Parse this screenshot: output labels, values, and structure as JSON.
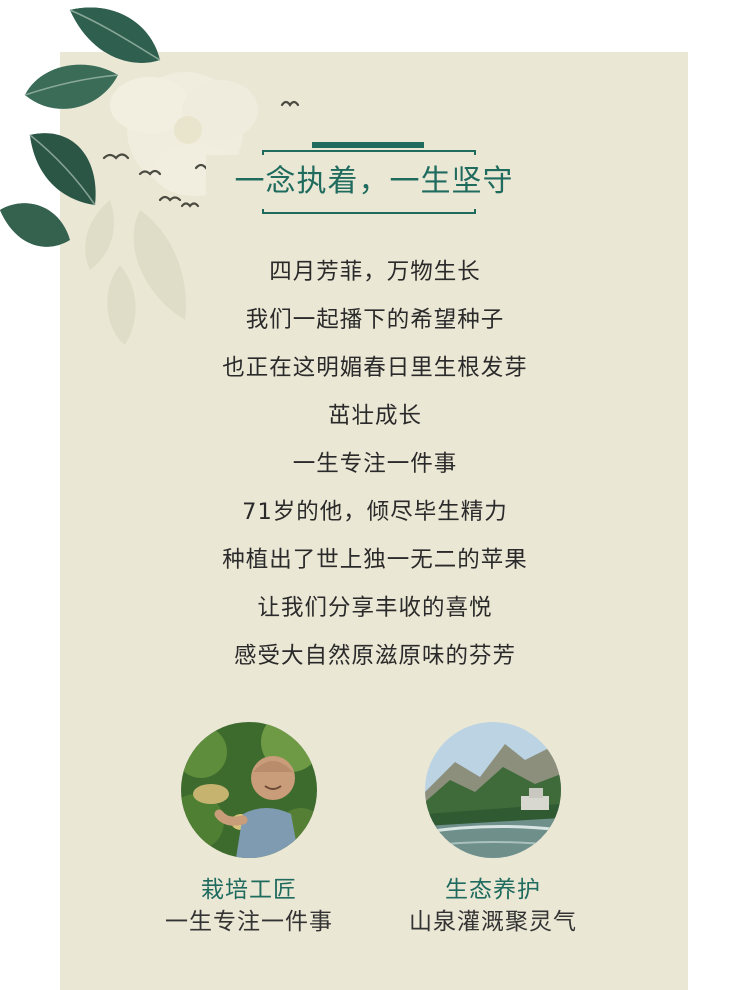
{
  "title": "一念执着，一生坚守",
  "poem": [
    "四月芳菲，万物生长",
    "我们一起播下的希望种子",
    "也正在这明媚春日里生根发芽",
    "茁壮成长",
    "一生专注一件事",
    "71岁的他，倾尽毕生精力",
    "种植出了世上独一无二的苹果",
    "让我们分享丰收的喜悦",
    "感受大自然原滋原味的芬芳"
  ],
  "features": [
    {
      "title": "栽培工匠",
      "subtitle": "一生专注一件事",
      "image": "farmer-photo"
    },
    {
      "title": "生态养护",
      "subtitle": "山泉灌溉聚灵气",
      "image": "mountain-spring-photo"
    }
  ],
  "colors": {
    "accent": "#1f6b5e",
    "card_background": "#ebe7d5",
    "text": "#2a2a2a"
  }
}
